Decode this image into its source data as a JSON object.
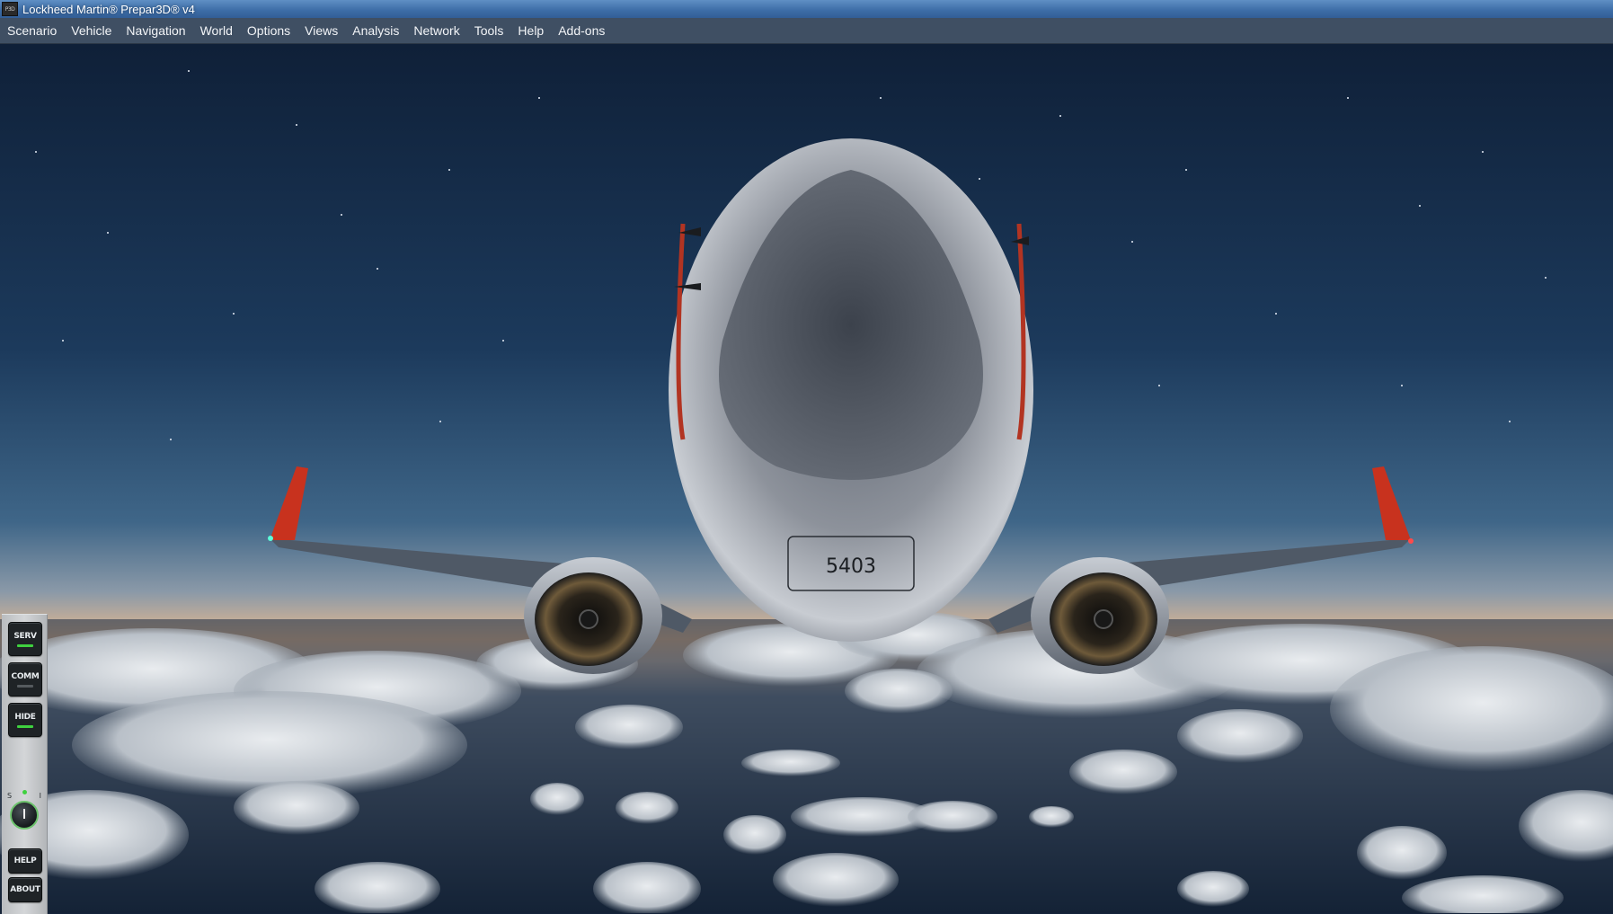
{
  "window": {
    "icon_label": "P3D",
    "title": "Lockheed Martin® Prepar3D® v4"
  },
  "menu": [
    {
      "label": "Scenario"
    },
    {
      "label": "Vehicle"
    },
    {
      "label": "Navigation"
    },
    {
      "label": "World"
    },
    {
      "label": "Options"
    },
    {
      "label": "Views"
    },
    {
      "label": "Analysis"
    },
    {
      "label": "Network"
    },
    {
      "label": "Tools"
    },
    {
      "label": "Help"
    },
    {
      "label": "Add-ons"
    }
  ],
  "side_panel": {
    "serv_label": "SERV",
    "comm_label": "COMM",
    "hide_label": "HIDE",
    "knob_left_label": "S",
    "knob_right_label": "I",
    "help_label": "HELP",
    "about_label": "ABOUT",
    "led_active_color": "#3fd13f",
    "led_inactive_color": "#555a5e"
  },
  "scene": {
    "description_icon": "aircraft-view",
    "registration_text": "5403"
  },
  "colors": {
    "sky_top": "#0f2038",
    "sky_horizon": "#e6b98f",
    "menubar": "#3f4f63",
    "titlebar": "#3e6ea8",
    "winglet_red": "#c8321e"
  }
}
